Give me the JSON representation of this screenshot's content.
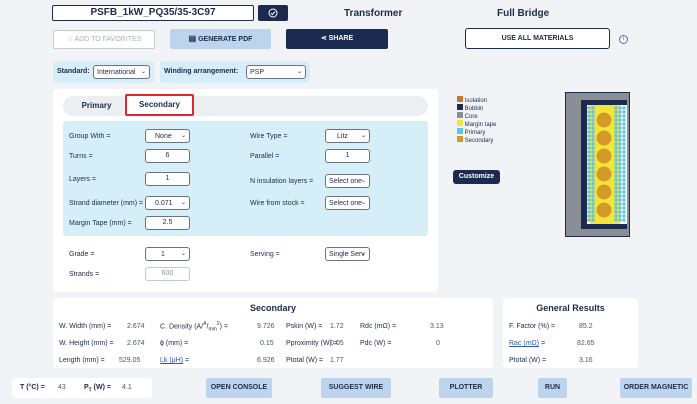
{
  "header": {
    "design_name": "PSFB_1kW_PQ35/35-3C97",
    "check_icon": "check-circle-icon",
    "magnetic_type": "Transformer",
    "topology": "Full Bridge"
  },
  "toolbar": {
    "favorites_label": "ADD TO FAVORITES",
    "generate_pdf_label": "GENERATE PDF",
    "share_label": "SHARE",
    "use_all_materials_label": "USE ALL MATERIALS",
    "info_icon": "info-icon"
  },
  "settings": {
    "standard_label": "Standard:",
    "standard_value": "International",
    "winding_label": "Winding arrangement:",
    "winding_value": "PSP"
  },
  "tabs": {
    "primary": "Primary",
    "secondary": "Secondary",
    "active": "Secondary"
  },
  "form": {
    "group_with_label": "Group With =",
    "group_with_value": "None",
    "turns_label": "Turns =",
    "turns_value": "6",
    "layers_label": "Layers =",
    "layers_value": "1",
    "strand_label": "Strand diameter (mm) =",
    "strand_value": "0.071",
    "margin_label": "Margin Tape (mm) =",
    "margin_value": "2.5",
    "wire_type_label": "Wire Type =",
    "wire_type_value": "Litz",
    "parallel_label": "Parallel =",
    "parallel_value": "1",
    "insulation_label": "N insulation layers =",
    "insulation_value": "Select one",
    "stock_label": "Wire from stock =",
    "stock_value": "Select one",
    "grade_label": "Grade =",
    "grade_value": "1",
    "strands_label": "Strands =",
    "strands_value": "600",
    "serving_label": "Serving =",
    "serving_value": "Single Serv"
  },
  "legend": {
    "items": [
      {
        "label": "Isolation",
        "color": "#c8782a"
      },
      {
        "label": "Bobbin",
        "color": "#1b2a4e"
      },
      {
        "label": "Core",
        "color": "#8a8f96"
      },
      {
        "label": "Margin tape",
        "color": "#f4e43a"
      },
      {
        "label": "Primary",
        "color": "#5ec6ec"
      },
      {
        "label": "Secondary",
        "color": "#d39a2a"
      }
    ],
    "customize_label": "Customize"
  },
  "secondary_results": {
    "title": "Secondary",
    "width_label": "W. Width (mm) =",
    "width_value": "2.674",
    "height_label": "W. Height (mm) =",
    "height_value": "2.674",
    "length_label": "Length (mm) =",
    "length_value": "529.05",
    "cdens_label_pre": "C. Density (A/",
    "cdens_label_sup1": "A",
    "cdens_label_mid": "mm",
    "cdens_label_sup2": "2",
    "cdens_label_post": ") =",
    "cdens_value": "9.726",
    "phi_label": "ϕ (mm) =",
    "phi_value": "0.15",
    "lk_label": "Lk (µH)",
    "lk_suffix": " =",
    "lk_value": "6.926",
    "pskin_label": "Pskin (W) =",
    "pskin_value": "1.72",
    "pprox_label": "Pproximity (W) =",
    "pprox_value": "0.05",
    "ptotal_label": "Ptotal (W) =",
    "ptotal_value": "1.77",
    "rdc_label": "Rdc (mΩ) =",
    "rdc_value": "3.13",
    "pdc_label": "Pdc (W) =",
    "pdc_value": "0"
  },
  "general_results": {
    "title": "General Results",
    "ffactor_label": "F. Factor (%) =",
    "ffactor_value": "85.2",
    "rac_label": "Rac (mΩ)",
    "rac_suffix": " =",
    "rac_value": "82.65",
    "ptotal_label": "Ptotal (W) =",
    "ptotal_value": "3.16"
  },
  "status": {
    "temp_label": "T (°C) =",
    "temp_value": "43",
    "pt_label_p": "P",
    "pt_label_sub": "T",
    "pt_label_rest": " (W) =",
    "pt_value": "4.1"
  },
  "actions": {
    "open_console": "OPEN CONSOLE",
    "suggest_wire": "SUGGEST WIRE",
    "plotter": "PLOTTER",
    "run": "RUN",
    "order_magnetic": "ORDER MAGNETIC"
  }
}
